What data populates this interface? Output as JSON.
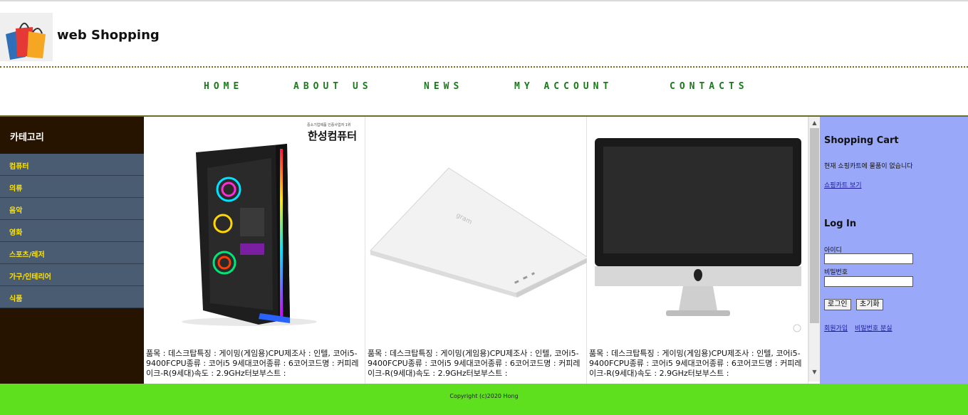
{
  "site": {
    "title": "web Shopping"
  },
  "nav": [
    "HOME",
    "ABOUT US",
    "NEWS",
    "MY ACCOUNT",
    "CONTACTS"
  ],
  "sidebar": {
    "heading": "카테고리",
    "items": [
      "컴퓨터",
      "의류",
      "음악",
      "영화",
      "스포츠/레저",
      "가구/인테리어",
      "식품"
    ]
  },
  "products": [
    {
      "brand": "한성컴퓨터",
      "brand_sub": "중소기업제품 인증사업자 1위",
      "desc": "품목 : 데스크탑특징 : 게이밍(게임용)CPU제조사 : 인텔, 코어i5-9400FCPU종류 : 코어i5 9세대코어종류 : 6코어코드명 : 커피레이크-R(9세대)속도 : 2.9GHz터보부스트 :"
    },
    {
      "desc": "품목 : 데스크탑특징 : 게이밍(게임용)CPU제조사 : 인텔, 코어i5-9400FCPU종류 : 코어i5 9세대코어종류 : 6코어코드명 : 커피레이크-R(9세대)속도 : 2.9GHz터보부스트 :"
    },
    {
      "desc": "품목 : 데스크탑특징 : 게이밍(게임용)CPU제조사 : 인텔, 코어i5-9400FCPU종류 : 코어i5 9세대코어종류 : 6코어코드명 : 커피레이크-R(9세대)속도 : 2.9GHz터보부스트 :"
    }
  ],
  "cart": {
    "title": "Shopping Cart",
    "empty_msg": "현재 쇼핑카트에 물품이 없습니다",
    "view_link": "쇼핑카트 보기"
  },
  "login": {
    "title": "Log In",
    "id_label": "아이디",
    "pw_label": "비밀번호",
    "login_btn": "로그인",
    "reset_btn": "초기화",
    "signup_link": "회원가입",
    "find_pw_link": "비밀번호 분실"
  },
  "footer": {
    "text": "Copyright (c)2020 Hong"
  },
  "colors": {
    "nav_text": "#1b7a1b",
    "sidebar_bg": "#261400",
    "category_bg": "#4a5c72",
    "category_text": "#ffe400",
    "right_bg": "#9aa8fa",
    "footer_bg": "#5ee01e"
  }
}
